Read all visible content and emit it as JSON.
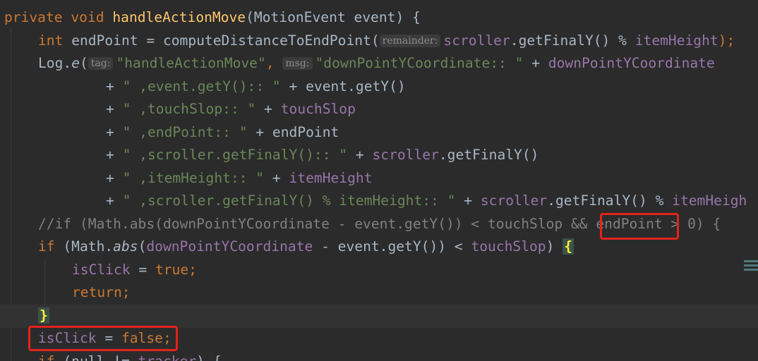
{
  "editor": {
    "lines": {
      "l1": {
        "kw": "private void ",
        "fn": "handleActionMove",
        "rest": "(MotionEvent event) {"
      },
      "l2": {
        "kw": "int ",
        "var": "endPoint = computeDistanceToEndPoint(",
        "hint": "remainder:",
        "field1": "scroller",
        "mid": ".getFinalY() % ",
        "field2": "itemHeight",
        "end": ");"
      },
      "l3": {
        "cls": "Log.",
        "call": "e",
        "open": "(",
        "hint1": "tag:",
        "str1": "\"handleActionMove\"",
        "comma": ", ",
        "hint2": "msg:",
        "str2": "\"downPointYCoordinate:: \"",
        "plus": " + ",
        "field": "downPointYCoordinate"
      },
      "l4": {
        "plus": "+ ",
        "str": "\" ,event.getY():: \"",
        "rest": " + event.getY()"
      },
      "l5": {
        "plus": "+ ",
        "str": "\" ,touchSlop:: \"",
        "plus2": " + ",
        "field": "touchSlop"
      },
      "l6": {
        "plus": "+ ",
        "str": "\" ,endPoint:: \"",
        "rest": " + endPoint"
      },
      "l7": {
        "plus": "+ ",
        "str": "\" ,scroller.getFinalY():: \"",
        "plus2": " + ",
        "field": "scroller",
        "rest": ".getFinalY()"
      },
      "l8": {
        "plus": "+ ",
        "str": "\" ,itemHeight:: \"",
        "plus2": " + ",
        "field": "itemHeight"
      },
      "l9": {
        "plus": "+ ",
        "str": "\" ,scroller.getFinalY() % itemHeight:: \"",
        "plus2": " + ",
        "field1": "scroller",
        "mid": ".getFinalY() % ",
        "field2": "itemHeigh"
      },
      "l10": {
        "comment": "//if (Math.abs(downPointYCoordinate - event.getY()) < touchSlop && ",
        "highlight": "endPoint",
        "rest": " > 0) {"
      },
      "l11": {
        "kw": "if ",
        "open": "(Math.",
        "call": "abs",
        "p": "(",
        "field1": "downPointYCoordinate",
        "mid": " - event.getY()) < ",
        "field2": "touchSlop",
        "close": ") ",
        "brace": "{"
      },
      "l12": {
        "field": "isClick",
        "eq": " = ",
        "kw": "true",
        "semi": ";"
      },
      "l13": {
        "kw": "return",
        "semi": ";"
      },
      "l14": {
        "brace": "}"
      },
      "l15": {
        "field": "isClick",
        "eq": " = ",
        "kw": "false",
        "semi": ";"
      },
      "l16": {
        "kw": "if ",
        "rest": "(null != ",
        "field": "tracker",
        "end": ") {"
      }
    }
  },
  "colors": {
    "background": "#2b2b2b",
    "keyword": "#cc7832",
    "function": "#ffc66d",
    "field": "#9876aa",
    "string": "#6a8759",
    "comment": "#808080",
    "annotation_box": "#e3231a"
  }
}
